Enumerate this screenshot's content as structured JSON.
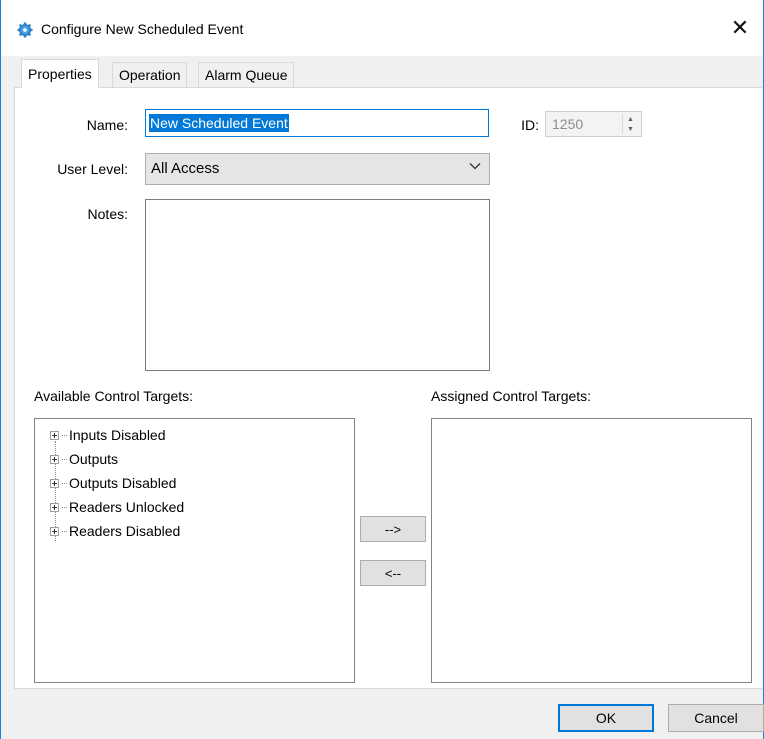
{
  "window": {
    "title": "Configure New Scheduled Event",
    "close_glyph": "✕"
  },
  "tabs": [
    {
      "label": "Properties",
      "active": true
    },
    {
      "label": "Operation",
      "active": false
    },
    {
      "label": "Alarm Queue",
      "active": false
    }
  ],
  "form": {
    "name_label": "Name:",
    "name_value": "New Scheduled Event",
    "id_label": "ID:",
    "id_value": "1250",
    "user_level_label": "User Level:",
    "user_level_value": "All Access",
    "notes_label": "Notes:",
    "notes_value": ""
  },
  "targets": {
    "available_label": "Available Control Targets:",
    "assigned_label": "Assigned Control Targets:",
    "available_items": [
      "Inputs Disabled",
      "Outputs",
      "Outputs Disabled",
      "Readers Unlocked",
      "Readers Disabled"
    ],
    "assign_button": "-->",
    "unassign_button": "<--"
  },
  "footer": {
    "ok_label": "OK",
    "cancel_label": "Cancel"
  },
  "icons": {
    "app": "gear-icon",
    "close": "close-icon",
    "expand": "plus-expander-icon",
    "dropdown": "chevron-down-icon",
    "spin_up": "spin-up-icon",
    "spin_down": "spin-down-icon"
  },
  "colors": {
    "accent": "#0078d7",
    "selection_text": "#ffffff",
    "window_border": "#1883d7",
    "disabled_text": "#8d8d8d"
  }
}
